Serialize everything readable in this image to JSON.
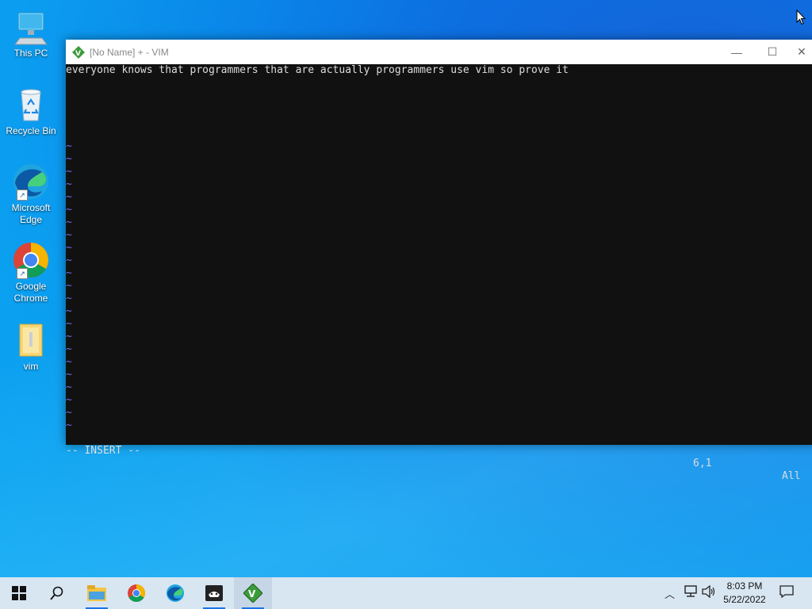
{
  "desktop": {
    "icons": [
      {
        "label": "This PC",
        "icon": "this-pc-icon"
      },
      {
        "label": "Recycle Bin",
        "icon": "recycle-bin-icon"
      },
      {
        "label": "Microsoft Edge",
        "label_line1": "Microsoft",
        "label_line2": "Edge",
        "icon": "edge-icon"
      },
      {
        "label": "Google Chrome",
        "label_line1": "Google",
        "label_line2": "Chrome",
        "icon": "chrome-icon"
      },
      {
        "label": "vim",
        "icon": "folder-icon"
      }
    ]
  },
  "vim_window": {
    "title": "[No Name] + - VIM",
    "lines": [
      "everyone knows that programmers that are actually programmers use vim so prove it"
    ],
    "tilde_char": "~",
    "tilde_count": 23,
    "status": {
      "mode": "-- INSERT --",
      "position": "6,1",
      "scroll": "All"
    },
    "controls": {
      "minimize": "—",
      "maximize": "☐",
      "close": "✕"
    }
  },
  "taskbar": {
    "apps": [
      "start",
      "search",
      "file-explorer",
      "chrome",
      "edge",
      "game-app",
      "vim"
    ],
    "clock": {
      "time": "8:03 PM",
      "date": "5/22/2022"
    }
  },
  "colors": {
    "tilde": "#6d6de8",
    "editor_bg": "#111111",
    "taskbar_bg": "#d8e6f2"
  }
}
